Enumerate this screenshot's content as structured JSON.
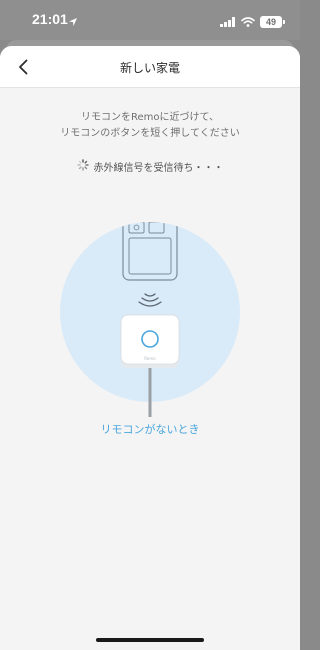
{
  "status_bar": {
    "time": "21:01",
    "battery": "49",
    "icons": [
      "location-arrow-icon",
      "signal-icon",
      "wifi-icon",
      "battery-icon"
    ]
  },
  "nav": {
    "title": "新しい家電",
    "back_icon": "chevron-left-icon"
  },
  "instructions": {
    "line1": "リモコンをRemoに近づけて、",
    "line2": "リモコンのボタンを短く押してください"
  },
  "waiting": {
    "text": "赤外線信号を受信待ち・・・",
    "icon": "spinner-icon"
  },
  "illustration": {
    "device_label": "Remo",
    "icons": [
      "remote-control-icon",
      "signal-waves-icon",
      "remo-device-icon"
    ]
  },
  "no_remote_link": "リモコンがないとき",
  "colors": {
    "accent": "#4aa6dc",
    "circle_fill": "#d9eaf8",
    "sheet_bg": "#f4f4f4",
    "status_bg": "#8f8f8f"
  }
}
